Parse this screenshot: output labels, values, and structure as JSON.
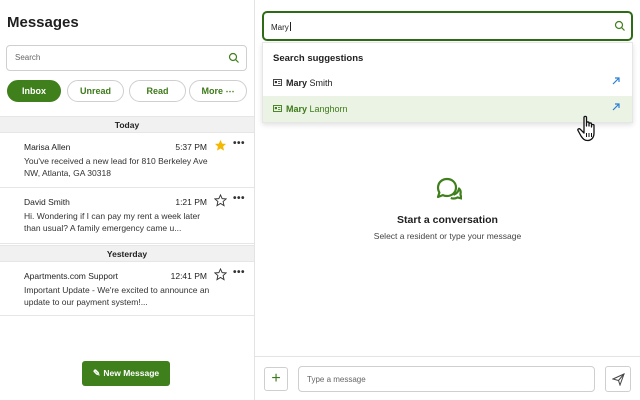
{
  "sidebar": {
    "title": "Messages",
    "search": {
      "placeholder": "Search"
    },
    "filters": [
      {
        "label": "Inbox",
        "active": true
      },
      {
        "label": "Unread",
        "active": false
      },
      {
        "label": "Read",
        "active": false
      },
      {
        "label": "More ⋯",
        "active": false
      }
    ],
    "groups": [
      {
        "day": "Today",
        "messages": [
          {
            "name": "Marisa Allen",
            "time": "5:37 PM",
            "starred": true,
            "preview": "You've received a new lead for 810 Berkeley Ave NW, Atlanta, GA 30318"
          },
          {
            "name": "David Smith",
            "time": "1:21 PM",
            "starred": false,
            "preview": "Hi. Wondering if I can pay my rent a week later than usual? A family emergency came u..."
          }
        ]
      },
      {
        "day": "Yesterday",
        "messages": [
          {
            "name": "Apartments.com Support",
            "time": "12:41 PM",
            "starred": false,
            "preview": "Important Update - We're excited to announce an update to our payment system!..."
          }
        ]
      }
    ],
    "more_label": "•••",
    "new_message_label": "New Message"
  },
  "main": {
    "search": {
      "value": "Mary"
    },
    "suggestions": {
      "header": "Search suggestions",
      "items": [
        {
          "match": "Mary",
          "rest": " Smith",
          "highlighted": false
        },
        {
          "match": "Mary",
          "rest": " Langhorn",
          "highlighted": true
        }
      ]
    },
    "empty_state": {
      "title": "Start a conversation",
      "subtitle": "Select a resident or type your message"
    },
    "composer": {
      "add_label": "+",
      "placeholder": "Type a message"
    }
  },
  "colors": {
    "accent": "#3f7f1c",
    "star": "#f5b800",
    "highlight": "#eaf3e4"
  }
}
